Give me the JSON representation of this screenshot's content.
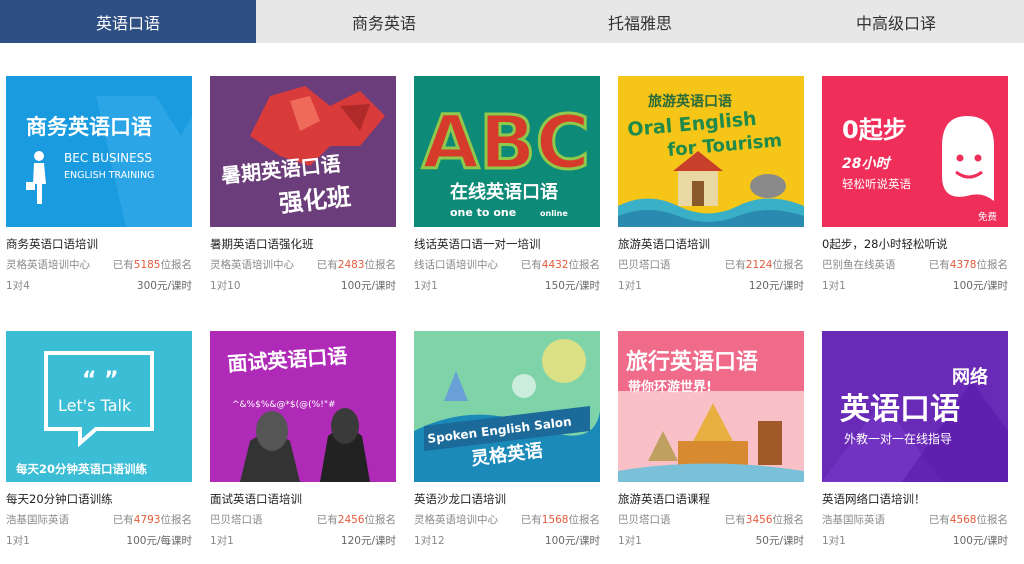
{
  "tabs": [
    {
      "label": "英语口语",
      "active": true
    },
    {
      "label": "商务英语",
      "active": false
    },
    {
      "label": "托福雅思",
      "active": false
    },
    {
      "label": "中高级口译",
      "active": false
    }
  ],
  "courses": [
    {
      "title": "商务英语口语培训",
      "org": "灵格英语培训中心",
      "enrolled_prefix": "已有",
      "enrolled": "5185",
      "enrolled_suffix": "位报名",
      "mode": "1对4",
      "price": "300元/课时",
      "img": {
        "main": "商务英语口语",
        "sub1": "BEC BUSINESS",
        "sub2": "ENGLISH TRAINING"
      }
    },
    {
      "title": "暑期英语口语强化班",
      "org": "灵格英语培训中心",
      "enrolled_prefix": "已有",
      "enrolled": "2483",
      "enrolled_suffix": "位报名",
      "mode": "1对10",
      "price": "100元/课时",
      "img": {
        "line1": "暑期英语口语",
        "line2": "强化班"
      }
    },
    {
      "title": "线话英语口语一对一培训",
      "org": "线话口语培训中心",
      "enrolled_prefix": "已有",
      "enrolled": "4432",
      "enrolled_suffix": "位报名",
      "mode": "1对1",
      "price": "150元/课时",
      "img": {
        "letters": "ABC",
        "line1": "在线英语口语",
        "line2": "one to one",
        "line3": "online"
      }
    },
    {
      "title": "旅游英语口语培训",
      "org": "巴贝塔口语",
      "enrolled_prefix": "已有",
      "enrolled": "2124",
      "enrolled_suffix": "位报名",
      "mode": "1对1",
      "price": "120元/课时",
      "img": {
        "line1": "旅游英语口语",
        "line2": "Oral English",
        "line3": "for Tourism"
      }
    },
    {
      "title": "0起步，28小时轻松听说",
      "org": "巴别鱼在线英语",
      "enrolled_prefix": "已有",
      "enrolled": "4378",
      "enrolled_suffix": "位报名",
      "mode": "1对1",
      "price": "100元/课时",
      "img": {
        "line1": "0起步",
        "line2": "28小时",
        "line3": "轻松听说英语",
        "badge": "免费"
      }
    },
    {
      "title": "每天20分钟口语训练",
      "org": "浩基国际英语",
      "enrolled_prefix": "已有",
      "enrolled": "4793",
      "enrolled_suffix": "位报名",
      "mode": "1对1",
      "price": "100元/每课时",
      "img": {
        "line1": "Let's Talk",
        "line2": "每天20分钟英语口语训练"
      }
    },
    {
      "title": "面试英语口语培训",
      "org": "巴贝塔口语",
      "enrolled_prefix": "已有",
      "enrolled": "2456",
      "enrolled_suffix": "位报名",
      "mode": "1对1",
      "price": "120元/课时",
      "img": {
        "line1": "面试英语口语",
        "line2": "^&%$%&@*$(@(%!\"#"
      }
    },
    {
      "title": "英语沙龙口语培训",
      "org": "灵格英语培训中心",
      "enrolled_prefix": "已有",
      "enrolled": "1568",
      "enrolled_suffix": "位报名",
      "mode": "1对12",
      "price": "100元/课时",
      "img": {
        "line1": "Spoken English Salon",
        "line2": "灵格英语"
      }
    },
    {
      "title": "旅游英语口语课程",
      "org": "巴贝塔口语",
      "enrolled_prefix": "已有",
      "enrolled": "3456",
      "enrolled_suffix": "位报名",
      "mode": "1对1",
      "price": "50元/课时",
      "img": {
        "line1": "旅行英语口语",
        "line2": "带你环游世界!"
      }
    },
    {
      "title": "英语网络口语培训！",
      "org": "浩基国际英语",
      "enrolled_prefix": "已有",
      "enrolled": "4568",
      "enrolled_suffix": "位报名",
      "mode": "1对1",
      "price": "100元/课时",
      "img": {
        "line1": "网络",
        "line2": "英语口语",
        "line3": "外教一对一在线指导"
      }
    }
  ],
  "colors": {
    "tab_active": "#2e4f84",
    "tab_bar": "#e7e7e7",
    "enroll_count": "#e25b3b"
  }
}
